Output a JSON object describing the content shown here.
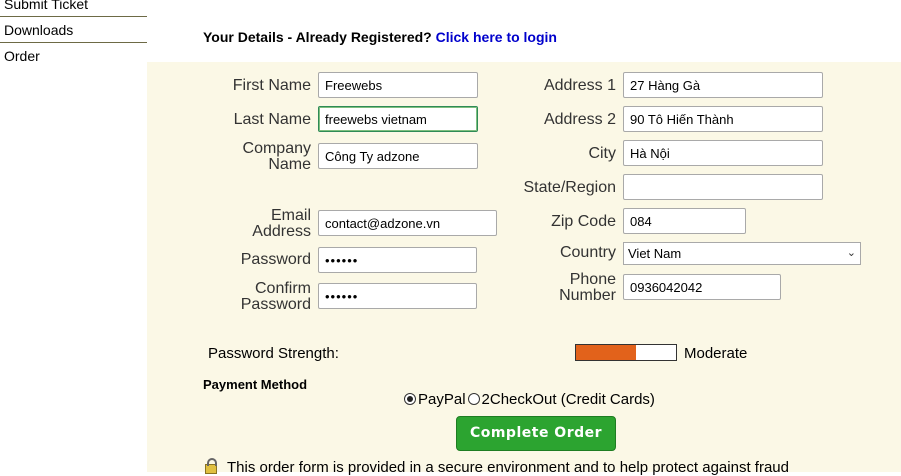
{
  "sidebar": {
    "items": [
      {
        "label": "Submit Ticket"
      },
      {
        "label": "Downloads"
      },
      {
        "label": "Order"
      }
    ]
  },
  "details": {
    "heading": "Your Details - Already Registered?",
    "login_link": "Click here to login"
  },
  "form": {
    "first_name": {
      "label": "First Name",
      "value": "Freewebs"
    },
    "last_name": {
      "label": "Last Name",
      "value": "freewebs vietnam"
    },
    "company_name": {
      "label_line1": "Company",
      "label_line2": "Name",
      "value": "Công Ty adzone"
    },
    "email": {
      "label_line1": "Email",
      "label_line2": "Address",
      "value": "contact@adzone.vn"
    },
    "password": {
      "label": "Password",
      "value": "••••••"
    },
    "confirm_password": {
      "label_line1": "Confirm",
      "label_line2": "Password",
      "value": "••••••"
    },
    "address1": {
      "label": "Address 1",
      "value": "27 Hàng Gà"
    },
    "address2": {
      "label": "Address 2",
      "value": "90 Tô Hiến Thành"
    },
    "city": {
      "label": "City",
      "value": "Hà Nội"
    },
    "state": {
      "label": "State/Region",
      "value": ""
    },
    "zip": {
      "label": "Zip Code",
      "value": "084"
    },
    "country": {
      "label": "Country",
      "value": "Viet Nam"
    },
    "phone": {
      "label_line1": "Phone",
      "label_line2": "Number",
      "value": "0936042042"
    }
  },
  "strength": {
    "label": "Password Strength:",
    "fill_fraction": 0.6,
    "fill_color": "#e2621b",
    "text": "Moderate"
  },
  "payment": {
    "heading": "Payment Method",
    "options": [
      {
        "label": "PayPal",
        "selected": true
      },
      {
        "label": "2CheckOut (Credit Cards)",
        "selected": false
      }
    ]
  },
  "actions": {
    "complete_order": "Complete Order"
  },
  "footer": {
    "secure_text": "This order form is provided in a secure environment and to help protect against fraud"
  }
}
